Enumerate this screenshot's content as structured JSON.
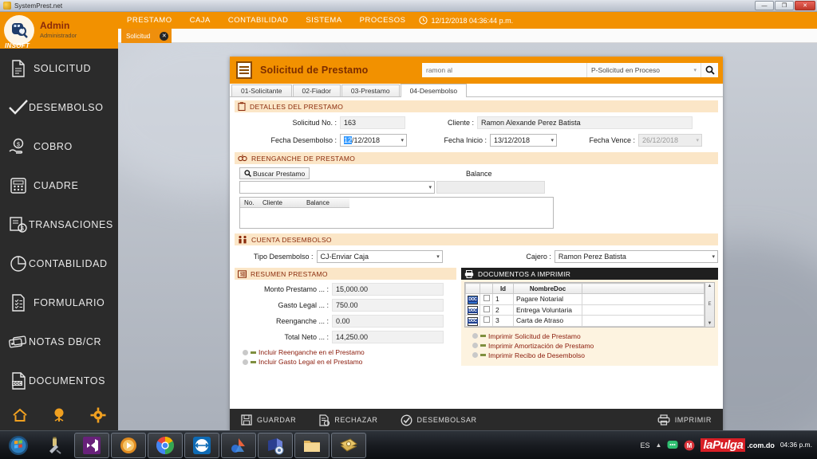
{
  "window": {
    "title": "SystemPrest.net",
    "controls": {
      "minimize": "—",
      "maximize": "❐",
      "close": "✕"
    }
  },
  "sidebar": {
    "user": {
      "name": "Admin",
      "role": "Administrador",
      "brand": "INSOFT"
    },
    "items": [
      {
        "label": "SOLICITUD",
        "icon": "document-icon"
      },
      {
        "label": "DESEMBOLSO",
        "icon": "check-icon"
      },
      {
        "label": "COBRO",
        "icon": "hand-money-icon"
      },
      {
        "label": "CUADRE",
        "icon": "calculator-icon"
      },
      {
        "label": "TRANSACIONES",
        "icon": "transactions-icon"
      },
      {
        "label": "CONTABILIDAD",
        "icon": "pie-chart-icon"
      },
      {
        "label": "FORMULARIO",
        "icon": "checklist-icon"
      },
      {
        "label": "NOTAS DB/CR",
        "icon": "cards-icon"
      },
      {
        "label": "DOCUMENTOS",
        "icon": "doc-file-icon"
      }
    ],
    "bottom_icons": [
      "home-icon",
      "tree-icon",
      "gear-icon"
    ]
  },
  "topmenu": {
    "items": [
      "PRESTAMO",
      "CAJA",
      "CONTABILIDAD",
      "SISTEMA",
      "PROCESOS"
    ],
    "clock": "12/12/2018 04:36:44 p.m."
  },
  "doctab": {
    "label": "Solicitud",
    "close": "✕"
  },
  "panel": {
    "title": "Solicitud de Prestamo",
    "search_value": "ramon al",
    "search_placeholder": "ramon al",
    "status_value": "P-Solicitud en Proceso",
    "search_button": "search-icon",
    "tabs": [
      {
        "label": "01-Solicitante",
        "active": false
      },
      {
        "label": "02-Fiador",
        "active": false
      },
      {
        "label": "03-Prestamo",
        "active": false
      },
      {
        "label": "04-Desembolso",
        "active": true
      }
    ]
  },
  "detalles": {
    "section_title": "DETALLES DEL PRESTAMO",
    "solicitud_label": "Solicitud No. :",
    "solicitud_value": "163",
    "cliente_label": "Cliente :",
    "cliente_value": "Ramon Alexande Perez Batista",
    "fecha_desembolso_label": "Fecha Desembolso :",
    "fecha_desembolso_sel": "12",
    "fecha_desembolso_rest": "/12/2018",
    "fecha_inicio_label": "Fecha Inicio :",
    "fecha_inicio_value": "13/12/2018",
    "fecha_vence_label": "Fecha Vence :",
    "fecha_vence_value": "26/12/2018"
  },
  "reenganche": {
    "section_title": "REENGANCHE DE PRESTAMO",
    "buscar_button": "Buscar Prestamo",
    "combo_value": "",
    "balance_label": "Balance",
    "balance_value": "",
    "grid_headers": [
      "No.",
      "Cliente",
      "Balance"
    ],
    "grid_rows": []
  },
  "cuenta": {
    "section_title": "CUENTA DESEMBOLSO",
    "tipo_label": "Tipo Desembolso :",
    "tipo_value": "CJ-Enviar Caja",
    "cajero_label": "Cajero :",
    "cajero_value": "Ramon Perez Batista"
  },
  "resumen": {
    "section_title": "RESUMEN PRESTAMO",
    "rows": [
      {
        "label": "Monto Prestamo ... :",
        "value": "15,000.00"
      },
      {
        "label": "Gasto Legal ... :",
        "value": "750.00"
      },
      {
        "label": "Reenganche ... :",
        "value": "0.00"
      },
      {
        "label": "Total Neto ... :",
        "value": "14,250.00"
      }
    ],
    "toggles": [
      "Incluir Reenganche en el Prestamo",
      "Incluir Gasto Legal en el Prestamo"
    ]
  },
  "documentos": {
    "section_title": "DOCUMENTOS A IMPRIMIR",
    "headers": [
      "",
      "",
      "Id",
      "NombreDoc"
    ],
    "rows": [
      {
        "id": "1",
        "nombre": "Pagare Notarial"
      },
      {
        "id": "2",
        "nombre": "Entrega Voluntaria"
      },
      {
        "id": "3",
        "nombre": "Carta de Atraso"
      }
    ],
    "toggles": [
      "Imprimir Solicitud de Prestamo",
      "Imprimir Amortización de Prestamo",
      "Imprimir Recibo de Desembolso"
    ],
    "scroll_marker": "E"
  },
  "footer": {
    "buttons": [
      {
        "label": "GUARDAR",
        "icon": "save-icon"
      },
      {
        "label": "RECHAZAR",
        "icon": "reject-doc-icon"
      },
      {
        "label": "DESEMBOLSAR",
        "icon": "check-circle-icon"
      }
    ],
    "print": {
      "label": "IMPRIMIR",
      "icon": "printer-icon"
    }
  },
  "taskbar": {
    "language": "ES",
    "clock_time": "04:36 p.m.",
    "watermark_red": "laPulga",
    "watermark_dom": ".com.do"
  },
  "colors": {
    "accent": "#f29100",
    "sidebar": "#2b2b2b",
    "section": "#fbe6c7",
    "section_text": "#8a2a0a",
    "dark_section": "#1f1f1f"
  }
}
